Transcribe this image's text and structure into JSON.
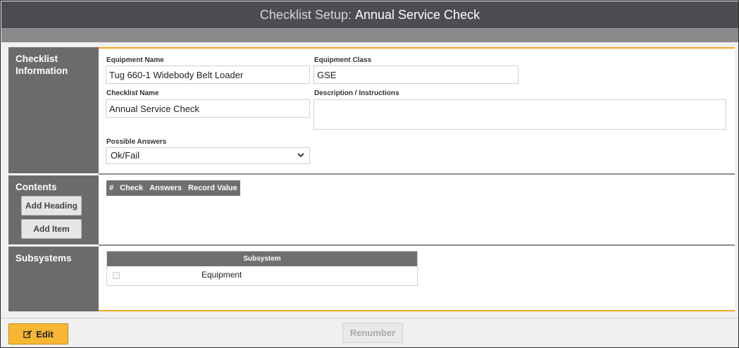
{
  "header": {
    "title_prefix": "Checklist Setup:",
    "title_name": "Annual Service Check"
  },
  "checklist_info": {
    "section_label": "Checklist Information",
    "equipment_name_label": "Equipment Name",
    "equipment_name_value": "Tug 660-1 Widebody Belt Loader",
    "equipment_class_label": "Equipment Class",
    "equipment_class_value": "GSE",
    "checklist_name_label": "Checklist Name",
    "checklist_name_value": "Annual Service Check",
    "description_label": "Description / Instructions",
    "description_value": "",
    "possible_answers_label": "Possible Answers",
    "possible_answers_value": "Ok/Fail"
  },
  "contents": {
    "section_label": "Contents",
    "add_heading_label": "Add Heading",
    "add_item_label": "Add Item",
    "columns": [
      "#",
      "Check",
      "Answers",
      "Record Value"
    ]
  },
  "subsystems": {
    "section_label": "Subsystems",
    "column_header": "Subsystem",
    "rows": [
      {
        "name": "Equipment",
        "checked": false
      }
    ]
  },
  "footer": {
    "edit_label": "Edit",
    "renumber_label": "Renumber"
  },
  "colors": {
    "accent": "#f2a61e",
    "edit_button": "#f7b733",
    "title_bar": "#4c4c52",
    "section_label_bg": "#6b6b6b"
  }
}
